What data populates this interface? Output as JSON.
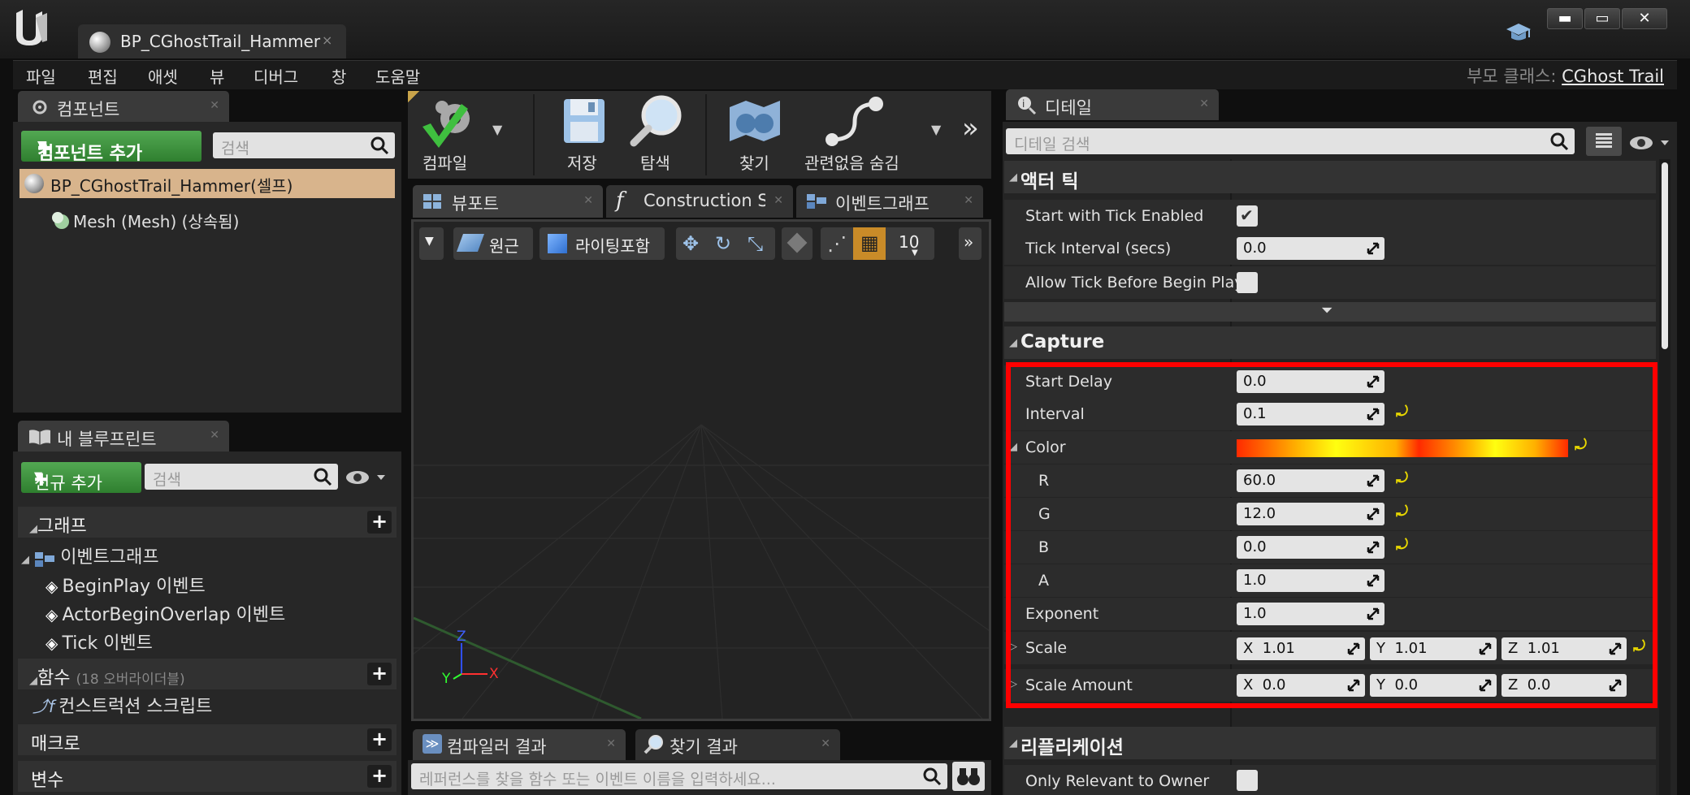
{
  "window": {
    "tab_title": "BP_CGhostTrail_Hammer",
    "tab_close": "×",
    "logo_text": "U",
    "min": "▬",
    "max": "▭",
    "close": "✕"
  },
  "menu": {
    "items": [
      "파일",
      "편집",
      "애셋",
      "뷰",
      "디버그",
      "창",
      "도움말"
    ],
    "parent_class_label": "부모 클래스:",
    "parent_class_value": "CGhost Trail"
  },
  "components": {
    "tab": "컴포넌트",
    "add_button": "컴포넌트 추가",
    "search_placeholder": "검색",
    "self_item": "BP_CGhostTrail_Hammer(셀프)",
    "mesh_item": "Mesh (Mesh) (상속됨)"
  },
  "my_blueprint": {
    "tab": "내 블루프린트",
    "new_button": "신규 추가",
    "search_placeholder": "검색",
    "graph_section": "그래프",
    "event_graph": "이벤트그래프",
    "events": [
      "BeginPlay 이벤트",
      "ActorBeginOverlap 이벤트",
      "Tick 이벤트"
    ],
    "functions_section": "함수",
    "functions_note": "(18 오버라이더블)",
    "construction_script": "컨스트럭션 스크립트",
    "macros_section": "매크로",
    "variables_section": "변수"
  },
  "toolbar": {
    "compile": "컴파일",
    "save": "저장",
    "browse": "탐색",
    "find": "찾기",
    "hide_unrelated": "관련없음 숨김"
  },
  "center_tabs": {
    "viewport": "뷰포트",
    "construction": "Construction Sc",
    "event_graph": "이벤트그래프"
  },
  "viewport": {
    "perspective": "원근",
    "lit": "라이팅포함",
    "grid_snap": "10",
    "axis_x": "X",
    "axis_y": "Y",
    "axis_z": "Z"
  },
  "bottom": {
    "compiler_results": "컴파일러 결과",
    "find_results": "찾기 결과",
    "search_placeholder": "레퍼런스를 찾을 함수 또는 이벤트 이름을 입력하세요..."
  },
  "details": {
    "tab": "디테일",
    "search_placeholder": "디테일 검색",
    "actor_tick": {
      "title": "액터 틱",
      "start_with_tick_label": "Start with Tick Enabled",
      "start_with_tick_checked": true,
      "tick_interval_label": "Tick Interval (secs)",
      "tick_interval_value": "0.0",
      "allow_tick_label": "Allow Tick Before Begin Play",
      "allow_tick_checked": false
    },
    "capture": {
      "title": "Capture",
      "start_delay_label": "Start Delay",
      "start_delay_value": "0.0",
      "interval_label": "Interval",
      "interval_value": "0.1",
      "color_label": "Color",
      "r_label": "R",
      "r_value": "60.0",
      "g_label": "G",
      "g_value": "12.0",
      "b_label": "B",
      "b_value": "0.0",
      "a_label": "A",
      "a_value": "1.0",
      "exponent_label": "Exponent",
      "exponent_value": "1.0",
      "scale_label": "Scale",
      "scale_x_label": "X",
      "scale_x": "1.01",
      "scale_y_label": "Y",
      "scale_y": "1.01",
      "scale_z_label": "Z",
      "scale_z": "1.01",
      "scale_amount_label": "Scale Amount",
      "scale_amount_x_label": "X",
      "scale_amount_x": "0.0",
      "scale_amount_y_label": "Y",
      "scale_amount_y": "0.0",
      "scale_amount_z_label": "Z",
      "scale_amount_z": "0.0"
    },
    "replication": {
      "title": "리플리케이션",
      "only_relevant_label": "Only Relevant to Owner",
      "only_relevant_checked": false
    }
  },
  "colors": {
    "highlight": "#ff0000",
    "reset_arrow": "#e8d700",
    "green_button": "#3f8f3f",
    "selected_row": "#d8b48c"
  }
}
